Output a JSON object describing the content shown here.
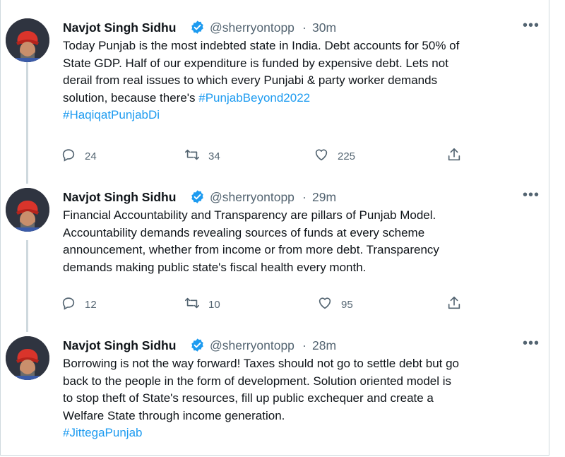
{
  "tweets": [
    {
      "name": "Navjot Singh Sidhu",
      "handle": "@sherryontopp",
      "separator": "·",
      "time": "30m",
      "more": "•••",
      "lines": [
        {
          "text": "Today Punjab is the most indebted state in India. Debt accounts for 50% of"
        },
        {
          "text": "State GDP. Half of our expenditure is funded by expensive debt. Lets not"
        },
        {
          "text": "derail from real issues to which every Punjabi & party worker demands"
        },
        {
          "text": "solution, because there's ",
          "tag": "#PunjabBeyond2022"
        },
        {
          "text": "",
          "tag": "#HaqiqatPunjabDi"
        }
      ],
      "replies": "24",
      "retweets": "34",
      "likes": "225"
    },
    {
      "name": "Navjot Singh Sidhu",
      "handle": "@sherryontopp",
      "separator": "·",
      "time": "29m",
      "more": "•••",
      "lines": [
        {
          "text": "Financial Accountability and Transparency are pillars of Punjab Model."
        },
        {
          "text": "Accountability demands revealing sources of funds at every scheme"
        },
        {
          "text": "announcement, whether from income or from more debt. Transparency"
        },
        {
          "text": "demands making public state's fiscal health every month."
        }
      ],
      "replies": "12",
      "retweets": "10",
      "likes": "95"
    },
    {
      "name": "Navjot Singh Sidhu",
      "handle": "@sherryontopp",
      "separator": "·",
      "time": "28m",
      "more": "•••",
      "lines": [
        {
          "text": "Borrowing is not the way forward! Taxes should not go to settle debt but go"
        },
        {
          "text": "back to the people in the form of development. Solution oriented model is"
        },
        {
          "text": "to stop theft of State's resources, fill up public exchequer and create a"
        },
        {
          "text": "Welfare State through income generation."
        },
        {
          "text": "",
          "tag": "#JittegaPunjab"
        }
      ]
    }
  ],
  "icons": {
    "verified": "verified-badge-icon",
    "reply": "reply-icon",
    "retweet": "retweet-icon",
    "like": "heart-icon",
    "share": "share-icon",
    "more": "more-options-icon"
  },
  "colors": {
    "link": "#1d9bf0",
    "secondary_text": "#536471",
    "verified": "#1d9bf0",
    "thread_line": "#cfd9de",
    "avatar_turban": "#d9342b"
  }
}
